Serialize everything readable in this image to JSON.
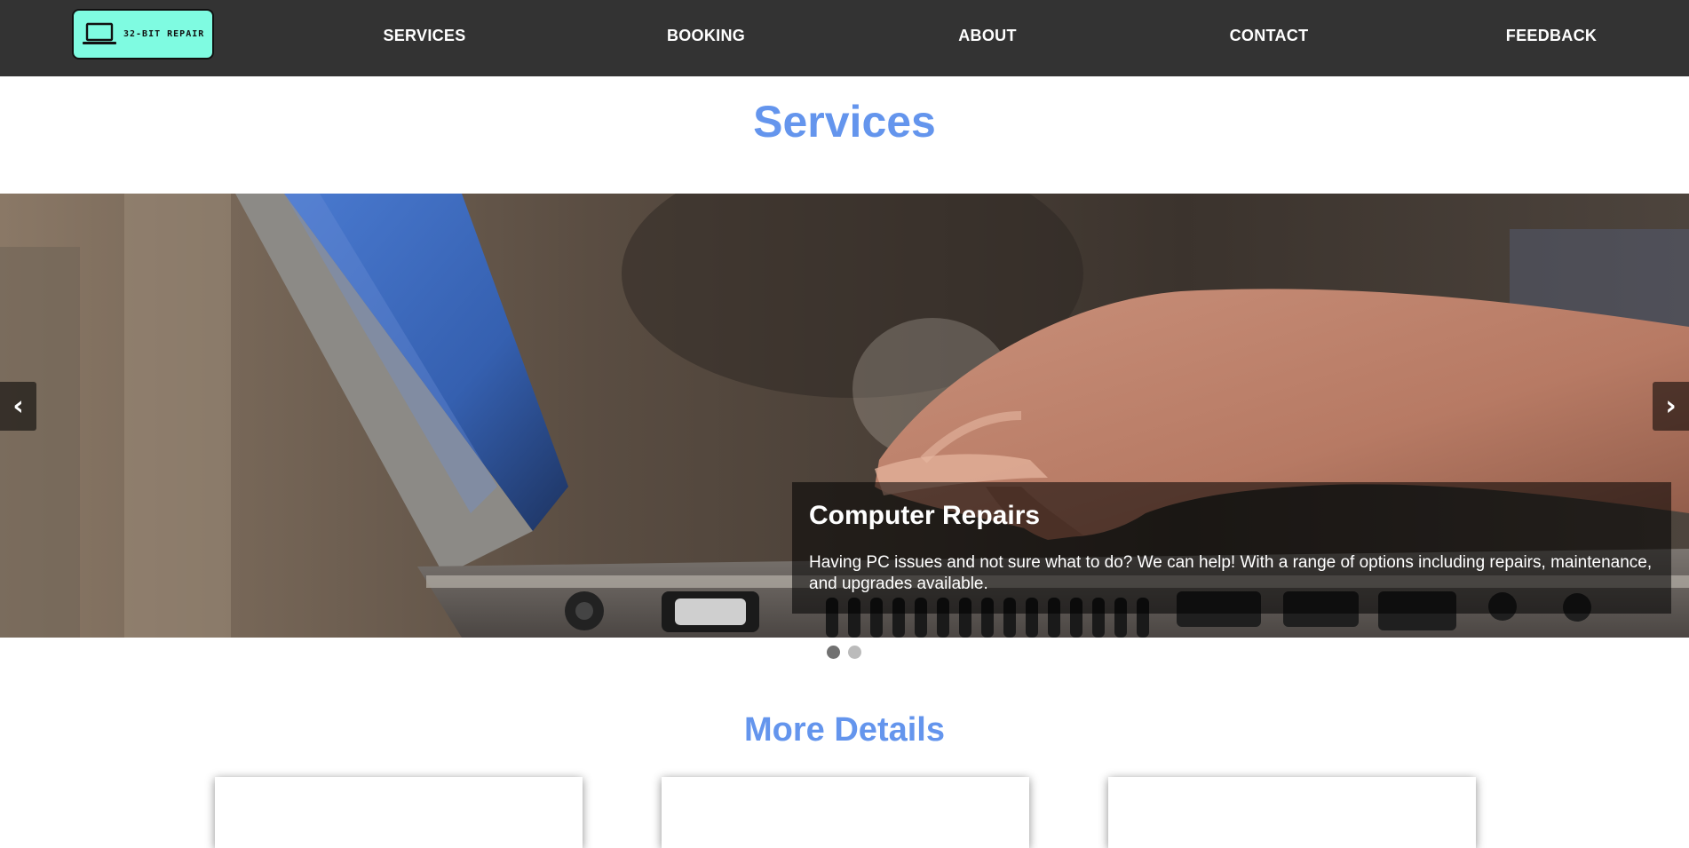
{
  "brand": {
    "logo_text": "32-BIT REPAIR",
    "logo_icon": "laptop-icon",
    "logo_bg_color": "#7ffbe1"
  },
  "nav": {
    "items": [
      {
        "label": "SERVICES"
      },
      {
        "label": "BOOKING"
      },
      {
        "label": "ABOUT"
      },
      {
        "label": "CONTACT"
      },
      {
        "label": "FEEDBACK"
      }
    ],
    "bg_color": "#333333"
  },
  "page": {
    "title": "Services",
    "accent_color": "#6495ed"
  },
  "carousel": {
    "prev_icon": "‹",
    "next_icon": "›",
    "active_slide": 1,
    "slide_count": 2,
    "slides": [
      {
        "title": "Computer Repairs",
        "text": "Having PC issues and not sure what to do? We can help! With a range of options including repairs, maintenance, and upgrades available."
      }
    ]
  },
  "details": {
    "title": "More Details",
    "card_count": 3
  }
}
